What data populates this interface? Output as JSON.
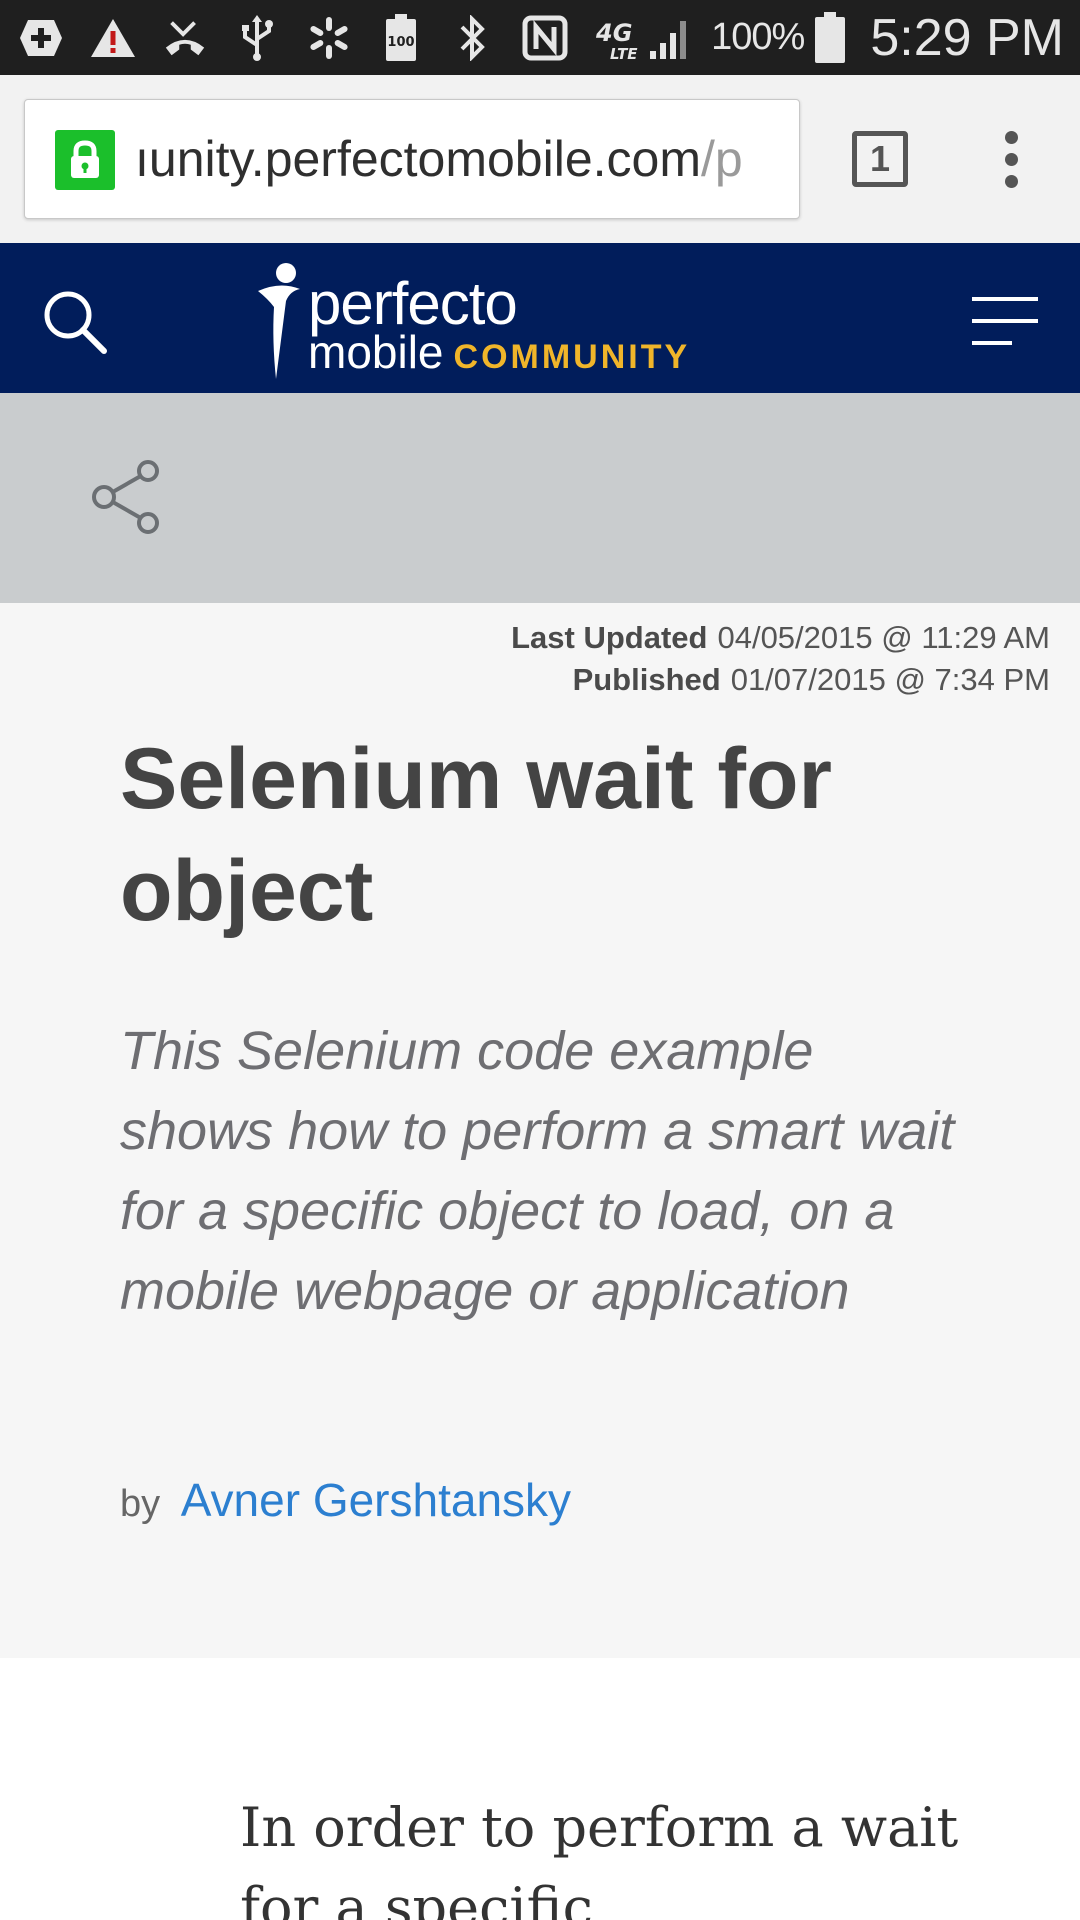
{
  "status_bar": {
    "icons": [
      "add-icon",
      "warning-icon",
      "missed-call-icon",
      "usb-icon",
      "sparkle-icon",
      "battery-100-icon",
      "bluetooth-icon",
      "nfc-icon",
      "lte-signal-icon"
    ],
    "lte_label": "4G",
    "battery_percent": "100%",
    "time": "5:29 PM"
  },
  "browser": {
    "url_host": "ıunity.perfectomobile.com",
    "url_path": "/p",
    "tab_count": "1",
    "secure_color": "#1bbf2b"
  },
  "site_header": {
    "logo_line1": "perfecto",
    "logo_line2": "mobile",
    "logo_community": "COMMUNITY",
    "background_color": "#011d5b",
    "accent_color": "#f0b52a"
  },
  "article": {
    "last_updated_label": "Last Updated",
    "last_updated_value": "04/05/2015 @ 11:29 AM",
    "published_label": "Published",
    "published_value": "01/07/2015 @ 7:34 PM",
    "title": "Selenium wait for object",
    "subtitle": "This Selenium code example shows how to perform a smart wait for a specific object to load, on a mobile webpage or application",
    "by_label": "by",
    "author": "Avner Gershtansky",
    "body_text": "In order to perform a wait for a specific"
  }
}
